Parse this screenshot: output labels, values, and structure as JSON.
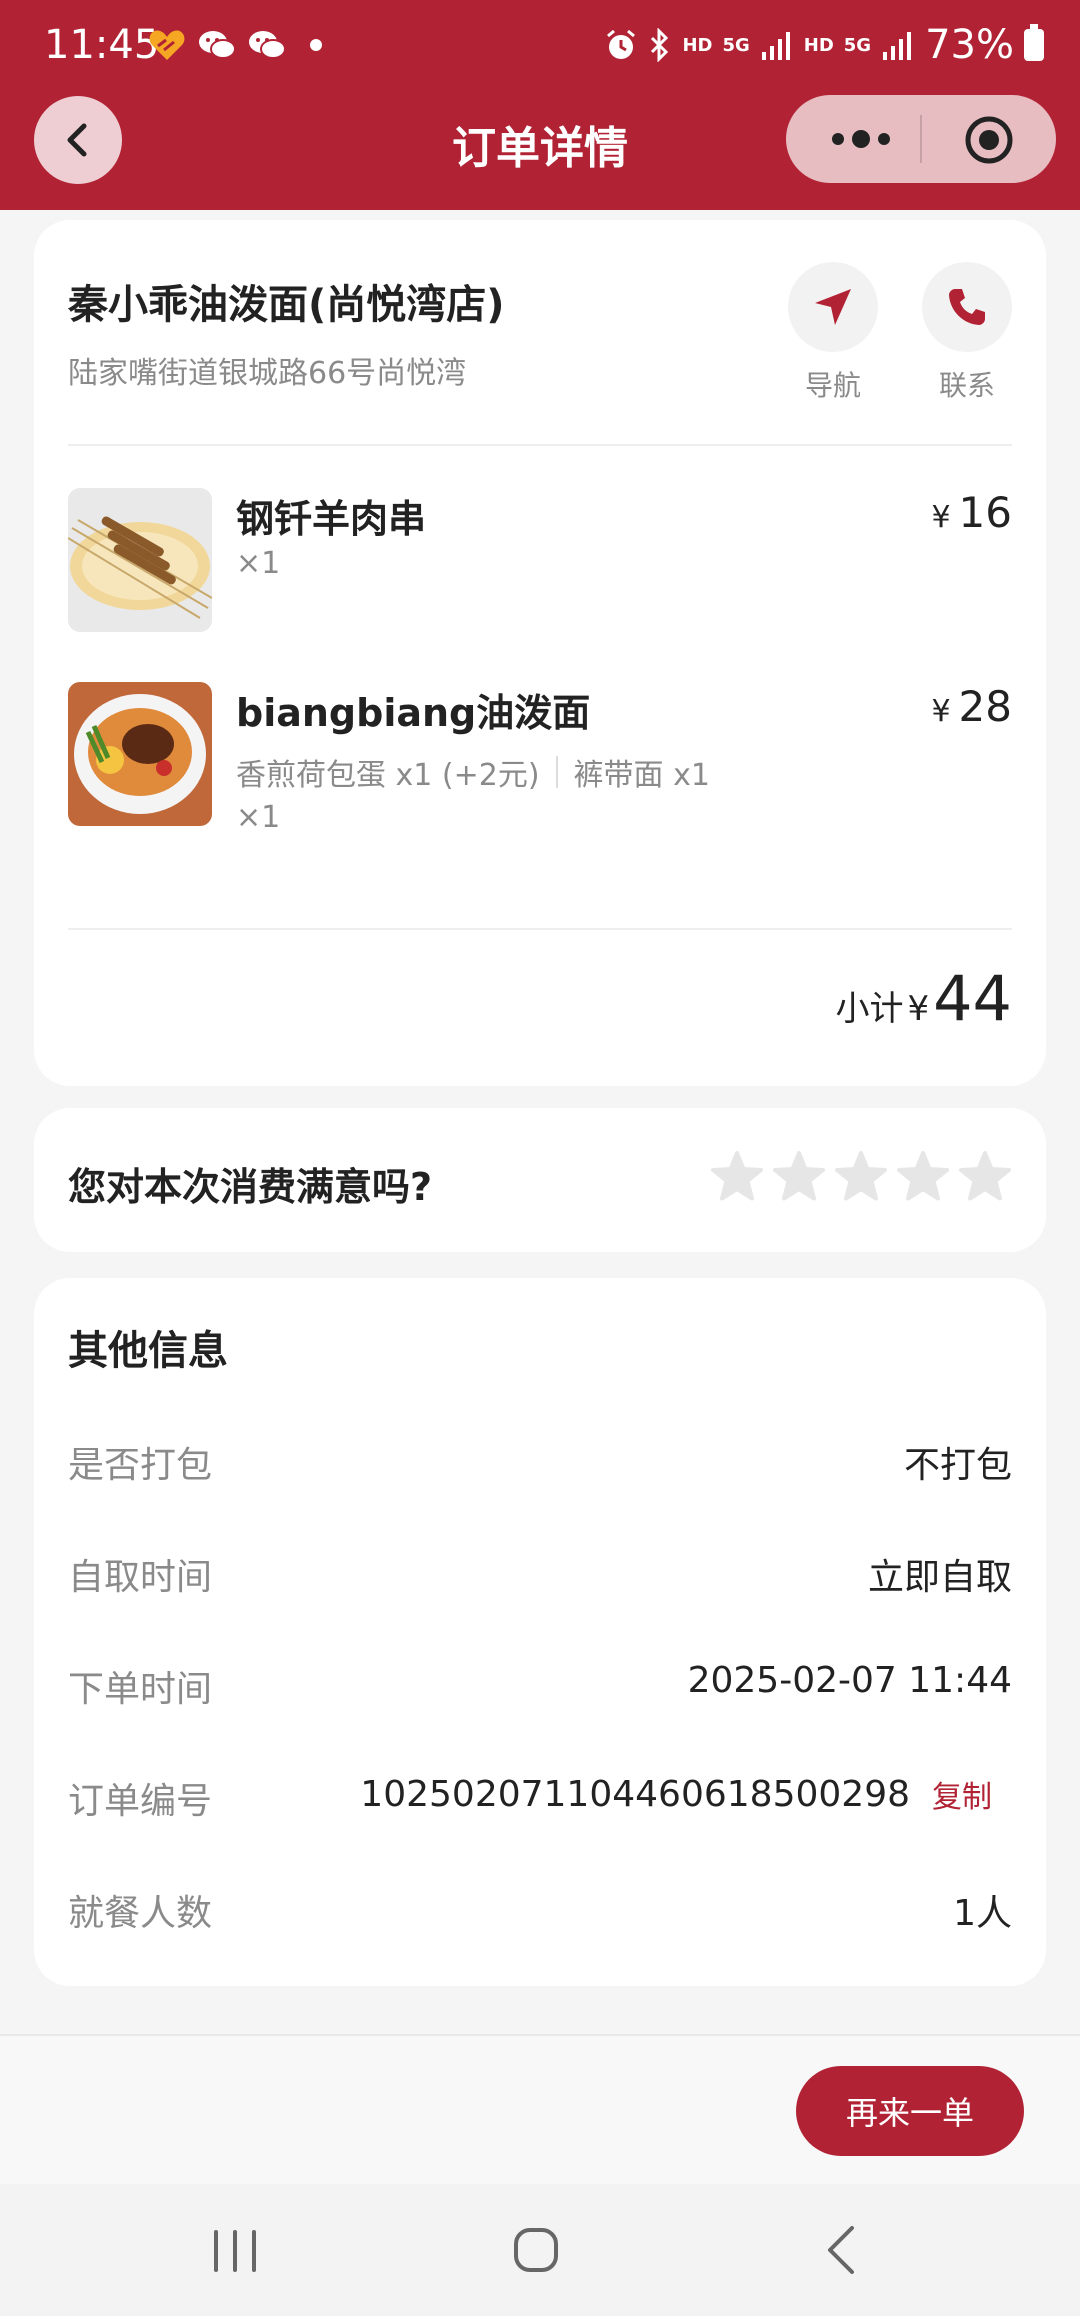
{
  "status_bar": {
    "time": "11:45",
    "hd1": "HD",
    "net1": "5G",
    "hd2": "HD",
    "net2": "5G",
    "battery": "73%"
  },
  "nav": {
    "title": "订单详情"
  },
  "shop": {
    "name": "秦小乖油泼面(尚悦湾店)",
    "address": "陆家嘴街道银城路66号尚悦湾",
    "nav_label": "导航",
    "call_label": "联系"
  },
  "items": [
    {
      "name": "钢钎羊肉串",
      "options": [],
      "qty": "×1",
      "currency": "¥",
      "price": "16"
    },
    {
      "name": "biangbiang油泼面",
      "options": [
        "香煎荷包蛋 x1 (+2元)",
        "裤带面 x1"
      ],
      "qty": "×1",
      "currency": "¥",
      "price": "28"
    }
  ],
  "subtotal": {
    "label": "小计",
    "currency": "¥",
    "amount": "44"
  },
  "rating": {
    "question": "您对本次消费满意吗?",
    "stars_selected": 0,
    "stars_total": 5
  },
  "info": {
    "title": "其他信息",
    "rows": [
      {
        "label": "是否打包",
        "value": "不打包"
      },
      {
        "label": "自取时间",
        "value": "立即自取"
      },
      {
        "label": "下单时间",
        "value": "2025-02-07 11:44"
      },
      {
        "label": "订单编号",
        "value": "10250207110446061850029​8",
        "action": "复制"
      },
      {
        "label": "就餐人数",
        "value": "1人"
      }
    ]
  },
  "footer": {
    "reorder_label": "再来一单"
  },
  "colors": {
    "brand": "#b12334",
    "text_muted": "#8a8a8a",
    "star_empty": "#e6e6e6"
  }
}
